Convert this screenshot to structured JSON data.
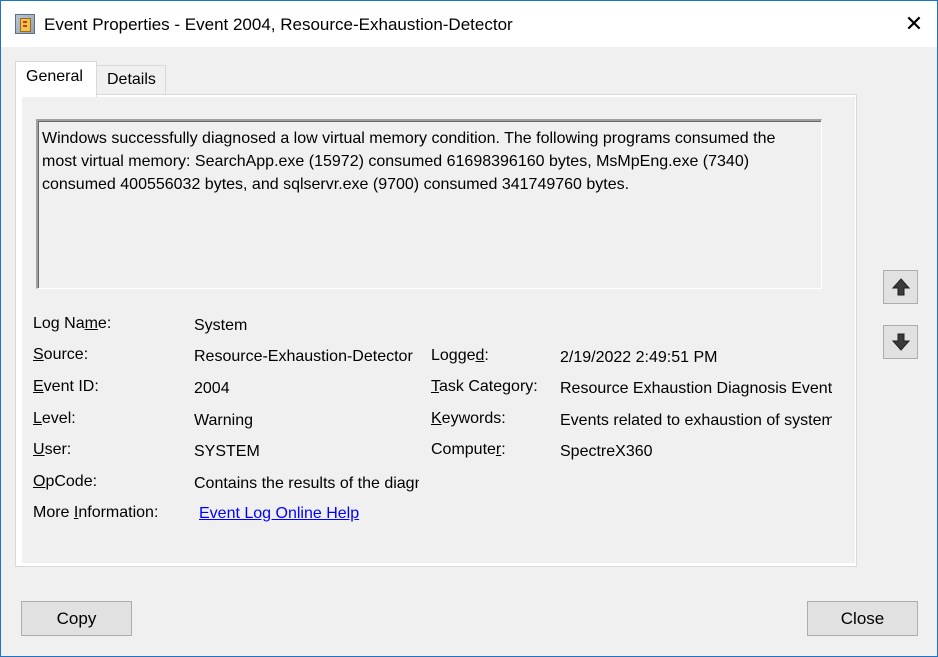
{
  "window": {
    "title": "Event Properties - Event 2004, Resource-Exhaustion-Detector",
    "close_glyph": "✕"
  },
  "tabs": [
    {
      "label": "General",
      "active": true
    },
    {
      "label": "Details",
      "active": false
    }
  ],
  "description": "Windows successfully diagnosed a low virtual memory condition. The following programs consumed the most virtual memory: SearchApp.exe (15972) consumed 61698396160 bytes, MsMpEng.exe (7340) consumed 400556032 bytes, and sqlservr.exe (9700) consumed 341749760 bytes.",
  "fields": {
    "log_name": {
      "label": "Log Name:",
      "value": "System"
    },
    "source": {
      "label": "Source:",
      "value": "Resource-Exhaustion-Detector"
    },
    "logged": {
      "label": "Logged:",
      "value": "2/19/2022 2:49:51 PM"
    },
    "event_id": {
      "label": "Event ID:",
      "value": "2004"
    },
    "task_category": {
      "label": "Task Category:",
      "value": "Resource Exhaustion Diagnosis Events"
    },
    "level": {
      "label": "Level:",
      "value": "Warning"
    },
    "keywords": {
      "label": "Keywords:",
      "value": "Events related to exhaustion of system commit limit (virtual memory)."
    },
    "user": {
      "label": "User:",
      "value": "SYSTEM"
    },
    "computer": {
      "label": "Computer:",
      "value": "SpectreX360"
    },
    "opcode": {
      "label": "OpCode:",
      "value": "Contains the results of the diagnosis."
    },
    "more_info": {
      "label": "More Information:",
      "link": "Event Log Online Help"
    }
  },
  "nav": {
    "up_icon": "arrow-up-icon",
    "down_icon": "arrow-down-icon"
  },
  "buttons": {
    "copy": "Copy",
    "close": "Close"
  }
}
